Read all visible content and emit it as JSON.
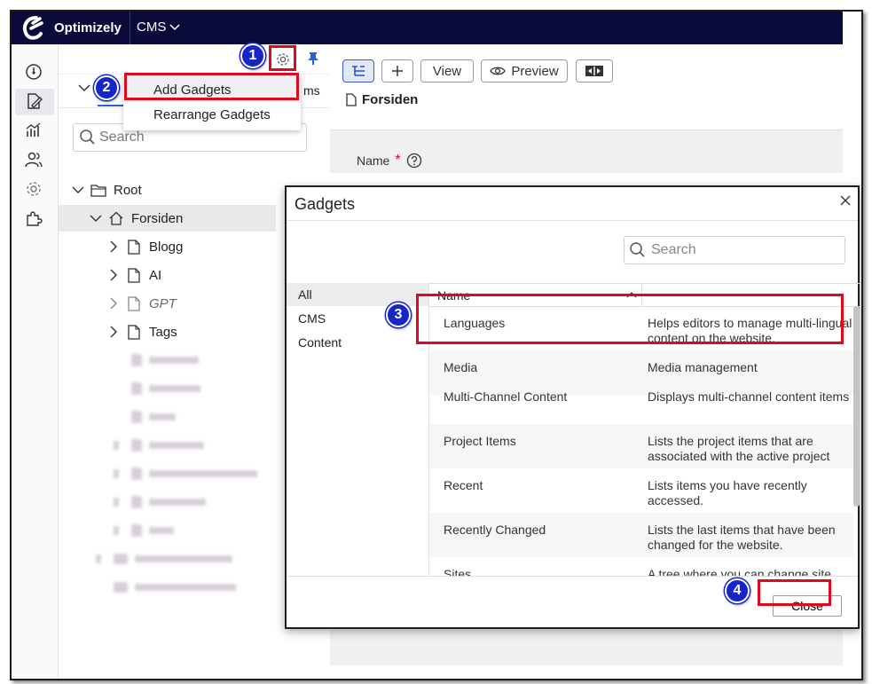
{
  "topbar": {
    "brand": "Optimizely",
    "product_menu": "CMS"
  },
  "tree_pane": {
    "tab_partial_label": "ms",
    "search_placeholder": "Search",
    "items": [
      {
        "label": "Root"
      },
      {
        "label": "Forsiden"
      },
      {
        "label": "Blogg"
      },
      {
        "label": "AI"
      },
      {
        "label": "GPT"
      },
      {
        "label": "Tags"
      }
    ]
  },
  "gadget_menu": {
    "add": "Add Gadgets",
    "rearrange": "Rearrange Gadgets"
  },
  "toolbar": {
    "view": "View",
    "preview": "Preview"
  },
  "content": {
    "page_title": "Forsiden",
    "name_label": "Name",
    "required_mark": "*"
  },
  "dialog": {
    "title": "Gadgets",
    "search_placeholder": "Search",
    "categories": [
      "All",
      "CMS",
      "Content"
    ],
    "column_name": "Name",
    "gadgets": [
      {
        "name": "Languages",
        "desc": "Helps editors to manage multi-lingual content on the website."
      },
      {
        "name": "Media",
        "desc": "Media management"
      },
      {
        "name": "Multi-Channel Content",
        "desc": "Displays multi-channel content items"
      },
      {
        "name": "Project Items",
        "desc": "Lists the project items that are associated with the active project"
      },
      {
        "name": "Recent",
        "desc": "Lists items you have recently accessed."
      },
      {
        "name": "Recently Changed",
        "desc": "Lists the last items that have been changed for the website."
      },
      {
        "name": "Sites",
        "desc": "A tree where you can change site"
      }
    ],
    "close_label": "Close"
  },
  "callouts": [
    "1",
    "2",
    "3",
    "4"
  ],
  "colors": {
    "topbar": "#0b0b3b",
    "highlight": "#e0081e",
    "badge": "#1626c9",
    "accent": "#2b5fd9"
  }
}
